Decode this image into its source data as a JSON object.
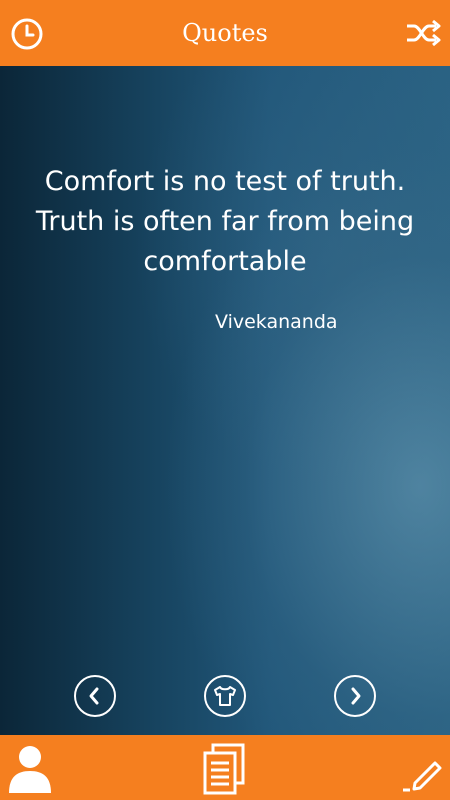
{
  "header": {
    "title": "Quotes",
    "left_icon": "clock-icon",
    "right_icon": "shuffle-icon"
  },
  "quote": {
    "text": "Comfort is no test of truth. Truth is often far from being comfortable",
    "author": "Vivekananda"
  },
  "controls": {
    "prev_icon": "chevron-left-icon",
    "center_icon": "tshirt-icon",
    "next_icon": "chevron-right-icon"
  },
  "footer": {
    "left_icon": "person-icon",
    "center_icon": "notes-icon",
    "right_icon": "pencil-icon"
  },
  "colors": {
    "accent": "#f57f1f",
    "background": "#1b4a68",
    "text": "#ffffff"
  }
}
